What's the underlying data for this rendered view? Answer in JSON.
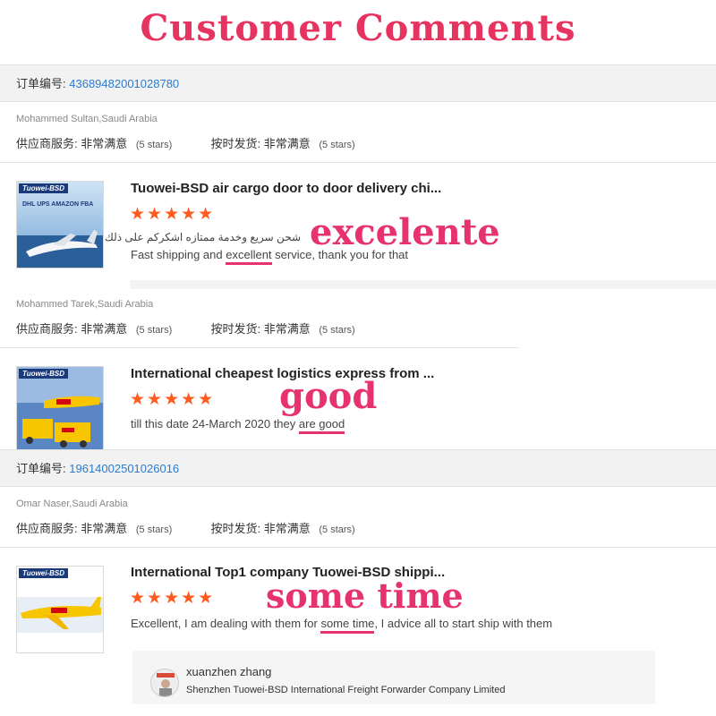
{
  "banner": {
    "title": "Customer Comments"
  },
  "orders": [
    {
      "label": "订单编号:",
      "number": "43689482001028780"
    },
    {
      "label": "订单编号:",
      "number": "19614002501026016"
    }
  ],
  "reviews": [
    {
      "buyer": "Mohammed Sultan,Saudi Arabia",
      "supplier_service_label": "供应商服务:",
      "supplier_service_value": "非常满意",
      "supplier_service_stars": "(5 stars)",
      "on_time_label": "按时发货:",
      "on_time_value": "非常满意",
      "on_time_stars": "(5 stars)",
      "thumb_brand": "Tuowei-BSD",
      "thumb_caption": "DHL UPS AMAZON FBA",
      "product_title": "Tuowei-BSD air cargo door to door delivery chi...",
      "stars": "★★★★★",
      "comment_arabic": "شحن سريع وخدمة ممتازه اشكركم على ذلك",
      "comment_pre": "Fast shipping and ",
      "comment_highlight": "excellent",
      "comment_post": " service, thank you for that",
      "callout": "excelente"
    },
    {
      "buyer": "Mohammed Tarek,Saudi Arabia",
      "supplier_service_label": "供应商服务:",
      "supplier_service_value": "非常满意",
      "supplier_service_stars": "(5 stars)",
      "on_time_label": "按时发货:",
      "on_time_value": "非常满意",
      "on_time_stars": "(5 stars)",
      "thumb_brand": "Tuowei-BSD",
      "product_title": "International cheapest logistics express from ...",
      "stars": "★★★★★",
      "comment_pre": "till this date 24-March 2020 they ",
      "comment_highlight": "are good",
      "comment_post": "",
      "callout": "good"
    },
    {
      "buyer": "Omar Naser,Saudi Arabia",
      "supplier_service_label": "供应商服务:",
      "supplier_service_value": "非常满意",
      "supplier_service_stars": "(5 stars)",
      "on_time_label": "按时发货:",
      "on_time_value": "非常满意",
      "on_time_stars": "(5 stars)",
      "thumb_brand": "Tuowei-BSD",
      "product_title": "International Top1 company Tuowei-BSD shippi...",
      "stars": "★★★★★",
      "comment_pre": "Excellent, I am dealing with them for ",
      "comment_highlight": "some time",
      "comment_post": ", I advice all to start ship with them",
      "callout": "some  time"
    }
  ],
  "reply": {
    "name": "xuanzhen zhang",
    "company": "Shenzhen Tuowei-BSD International Freight Forwarder Company Limited"
  }
}
